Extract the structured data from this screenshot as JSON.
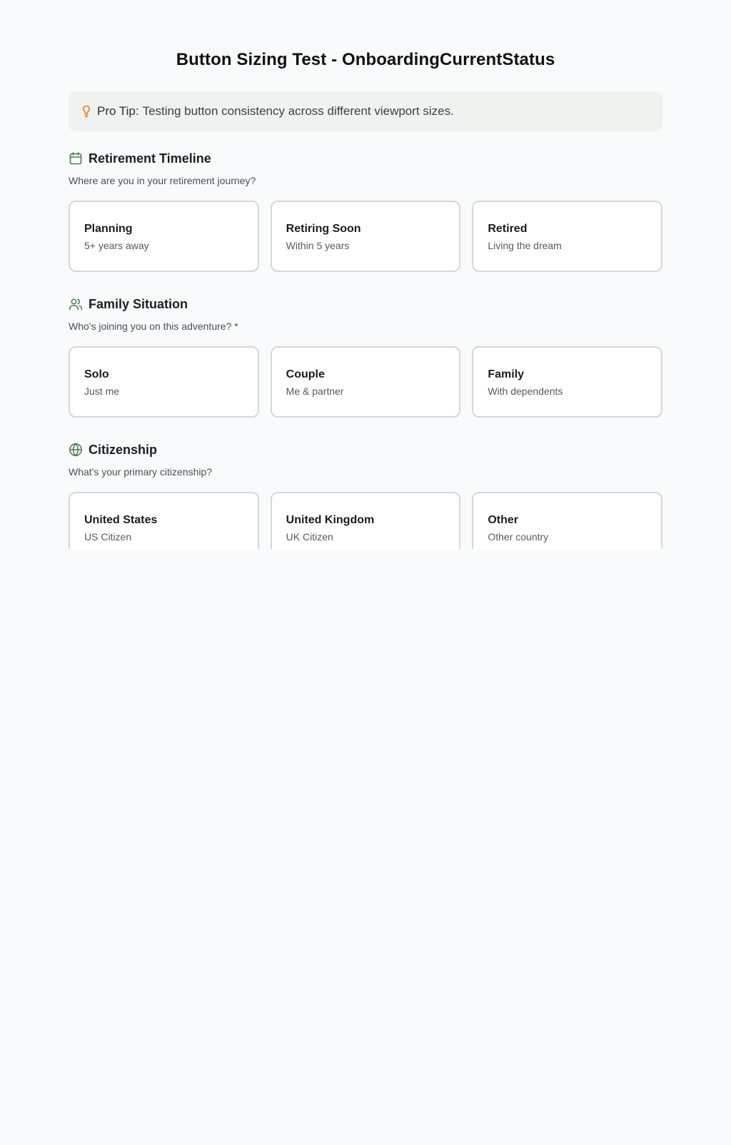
{
  "page": {
    "title": "Button Sizing Test - OnboardingCurrentStatus"
  },
  "tip": {
    "icon": "lightbulb-icon",
    "label": "Pro Tip:",
    "text": "Testing button consistency across different viewport sizes."
  },
  "colors": {
    "accent_green": "#4a7c4e",
    "tip_icon_orange": "#ea7a1a",
    "tip_background": "#eff2ef",
    "card_border": "#d5d7db",
    "page_background": "#f9fafb"
  },
  "sections": [
    {
      "icon": "calendar-icon",
      "title": "Retirement Timeline",
      "description": "Where are you in your retirement journey?",
      "options": [
        {
          "label": "Planning",
          "sub": "5+ years away"
        },
        {
          "label": "Retiring Soon",
          "sub": "Within 5 years"
        },
        {
          "label": "Retired",
          "sub": "Living the dream"
        }
      ]
    },
    {
      "icon": "users-icon",
      "title": "Family Situation",
      "description": "Who's joining you on this adventure? *",
      "options": [
        {
          "label": "Solo",
          "sub": "Just me"
        },
        {
          "label": "Couple",
          "sub": "Me & partner"
        },
        {
          "label": "Family",
          "sub": "With dependents"
        }
      ]
    },
    {
      "icon": "globe-icon",
      "title": "Citizenship",
      "description": "What's your primary citizenship?",
      "options": [
        {
          "label": "United States",
          "sub": "US Citizen"
        },
        {
          "label": "United Kingdom",
          "sub": "UK Citizen"
        },
        {
          "label": "Other",
          "sub": "Other country"
        }
      ]
    }
  ]
}
